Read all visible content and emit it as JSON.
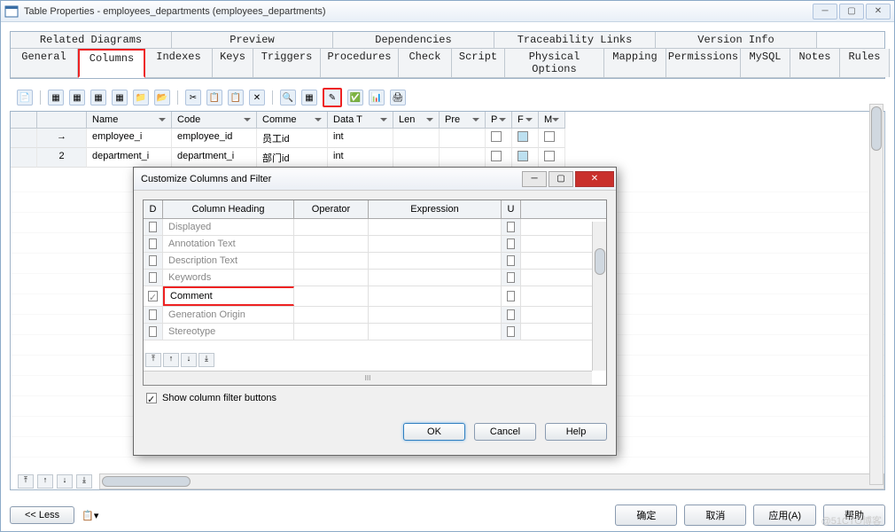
{
  "window": {
    "title": "Table Properties - employees_departments (employees_departments)"
  },
  "tabs_top": [
    "Related Diagrams",
    "Preview",
    "Dependencies",
    "Traceability Links",
    "Version Info"
  ],
  "tabs_bottom": [
    "General",
    "Columns",
    "Indexes",
    "Keys",
    "Triggers",
    "Procedures",
    "Check",
    "Script",
    "Physical Options",
    "Mapping",
    "Permissions",
    "MySQL",
    "Notes",
    "Rules"
  ],
  "active_tab": "Columns",
  "grid": {
    "headers": [
      "Name",
      "Code",
      "Comme",
      "Data T",
      "Len",
      "Pre",
      "P",
      "F",
      "M"
    ],
    "rows": [
      {
        "rh": "→",
        "name": "employee_i",
        "code": "employee_id",
        "comment": "员工id",
        "datatype": "int",
        "len": "",
        "pre": "",
        "p": true,
        "f": "blue",
        "m": true
      },
      {
        "rh": "2",
        "name": "department_i",
        "code": "department_i",
        "comment": "部门id",
        "datatype": "int",
        "len": "",
        "pre": "",
        "p": true,
        "f": "blue",
        "m": true
      }
    ]
  },
  "dialog": {
    "title": "Customize Columns and Filter",
    "headers": [
      "D",
      "Column Heading",
      "Operator",
      "Expression",
      "U"
    ],
    "rows": [
      {
        "checked": false,
        "label": "Displayed"
      },
      {
        "checked": false,
        "label": "Annotation Text"
      },
      {
        "checked": false,
        "label": "Description Text"
      },
      {
        "checked": false,
        "label": "Keywords"
      },
      {
        "checked": true,
        "label": "Comment",
        "highlight": true
      },
      {
        "checked": false,
        "label": "Generation Origin"
      },
      {
        "checked": false,
        "label": "Stereotype"
      }
    ],
    "show_filter": "Show column filter buttons",
    "ok": "OK",
    "cancel": "Cancel",
    "help": "Help"
  },
  "footer": {
    "less": "<< Less",
    "ok": "确定",
    "cancel": "取消",
    "apply": "应用(A)",
    "help": "帮助"
  },
  "watermark": "@51CTO博客"
}
